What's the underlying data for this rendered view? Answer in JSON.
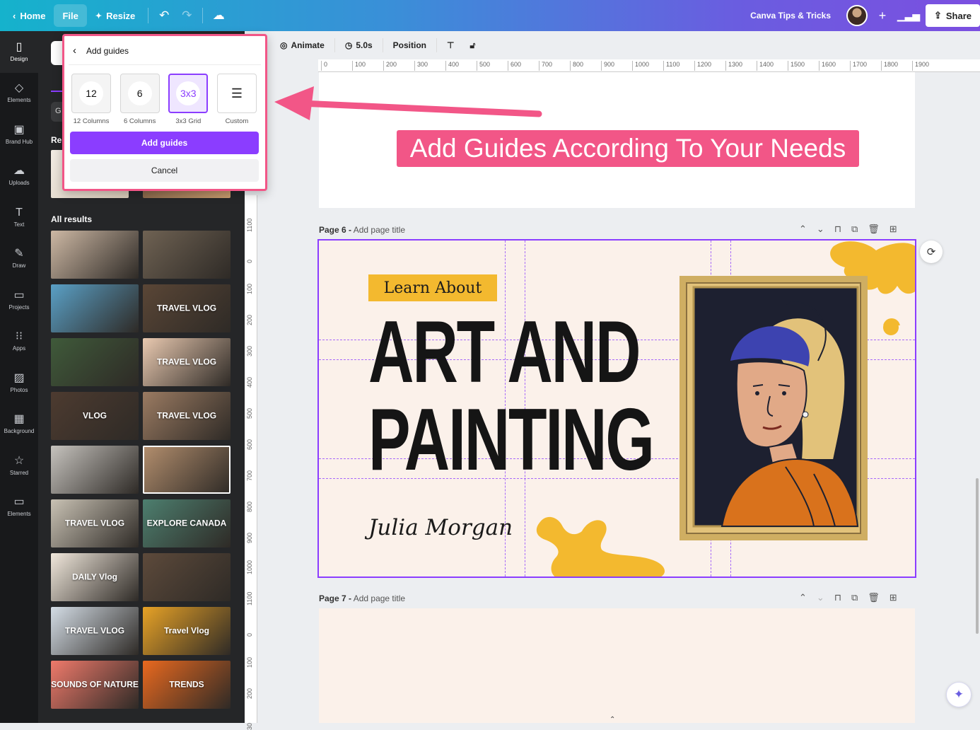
{
  "topbar": {
    "home": "Home",
    "file": "File",
    "resize": "Resize",
    "team_name": "Canva Tips & Tricks",
    "share": "Share"
  },
  "rail": [
    {
      "label": "Design",
      "icon": "▯"
    },
    {
      "label": "Elements",
      "icon": "◇"
    },
    {
      "label": "Brand Hub",
      "icon": "▣"
    },
    {
      "label": "Uploads",
      "icon": "☁"
    },
    {
      "label": "Text",
      "icon": "T"
    },
    {
      "label": "Draw",
      "icon": "✎"
    },
    {
      "label": "Projects",
      "icon": "▭"
    },
    {
      "label": "Apps",
      "icon": "⁝⁝"
    },
    {
      "label": "Photos",
      "icon": "▨"
    },
    {
      "label": "Background",
      "icon": "▦"
    },
    {
      "label": "Starred",
      "icon": "☆"
    },
    {
      "label": "Elements",
      "icon": "▭"
    }
  ],
  "panel": {
    "chip": "G",
    "recent_label": "Re",
    "all_results": "All results",
    "thumbs": [
      {
        "text": "",
        "bg": "#cdb8a4"
      },
      {
        "text": "",
        "bg": "#6f6253"
      },
      {
        "text": "",
        "bg": "#5aa0c6"
      },
      {
        "text": "TRAVEL VLOG",
        "bg": "#5a4636"
      },
      {
        "text": "",
        "bg": "#3f5a3a"
      },
      {
        "text": "TRAVEL VLOG",
        "bg": "#e9c9b0"
      },
      {
        "text": "VLOG",
        "bg": "#4d3b30"
      },
      {
        "text": "TRAVEL VLOG",
        "bg": "#9b7b62"
      },
      {
        "text": "",
        "bg": "#c6c3be"
      },
      {
        "text": "",
        "bg": "#b48f6e"
      },
      {
        "text": "TRAVEL VLOG",
        "bg": "#c9c2b4"
      },
      {
        "text": "EXPLORE CANADA",
        "bg": "#4d7f6f"
      },
      {
        "text": "DAILY Vlog",
        "bg": "#f1e8dc"
      },
      {
        "text": "",
        "bg": "#5d4a3b"
      },
      {
        "text": "TRAVEL VLOG",
        "bg": "#d4dde6"
      },
      {
        "text": "Travel Vlog",
        "bg": "#e7a226"
      },
      {
        "text": "SOUNDS OF NATURE",
        "bg": "#ef7a6b"
      },
      {
        "text": "TRENDS",
        "bg": "#e9691f"
      }
    ]
  },
  "toolbar": {
    "animate": "Animate",
    "duration": "5.0s",
    "position": "Position"
  },
  "ruler": {
    "h_ticks": [
      "0",
      "100",
      "200",
      "300",
      "400",
      "500",
      "600",
      "700",
      "800",
      "900",
      "1000",
      "1100",
      "1200",
      "1300",
      "1400",
      "1500",
      "1600",
      "1700",
      "1800",
      "1900"
    ],
    "v_ticks": [
      "1100",
      "0",
      "100",
      "200",
      "300",
      "400",
      "500",
      "600",
      "700",
      "800",
      "900",
      "1000",
      "1100",
      "0",
      "100",
      "200",
      "30"
    ]
  },
  "page6": {
    "label_num": "Page 6 -",
    "label_title": "Add page title",
    "learn_about": "Learn About",
    "title_line1": "ART AND",
    "title_line2": "PAINTING",
    "author": "Julia Morgan"
  },
  "page7": {
    "label_num": "Page 7 -",
    "label_title": "Add page title"
  },
  "annotation": "Add Guides According To Your Needs",
  "dropdown": {
    "title": "Add guides",
    "options": [
      {
        "value": "12",
        "label": "12 Columns"
      },
      {
        "value": "6",
        "label": "6 Columns"
      },
      {
        "value": "3x3",
        "label": "3x3 Grid"
      },
      {
        "value": "",
        "label": "Custom"
      }
    ],
    "add_button": "Add guides",
    "cancel_button": "Cancel"
  },
  "colors": {
    "accent": "#8b3dff",
    "annotation": "#f25687",
    "mustard": "#f3b92f",
    "page_bg": "#fbf1ea"
  }
}
